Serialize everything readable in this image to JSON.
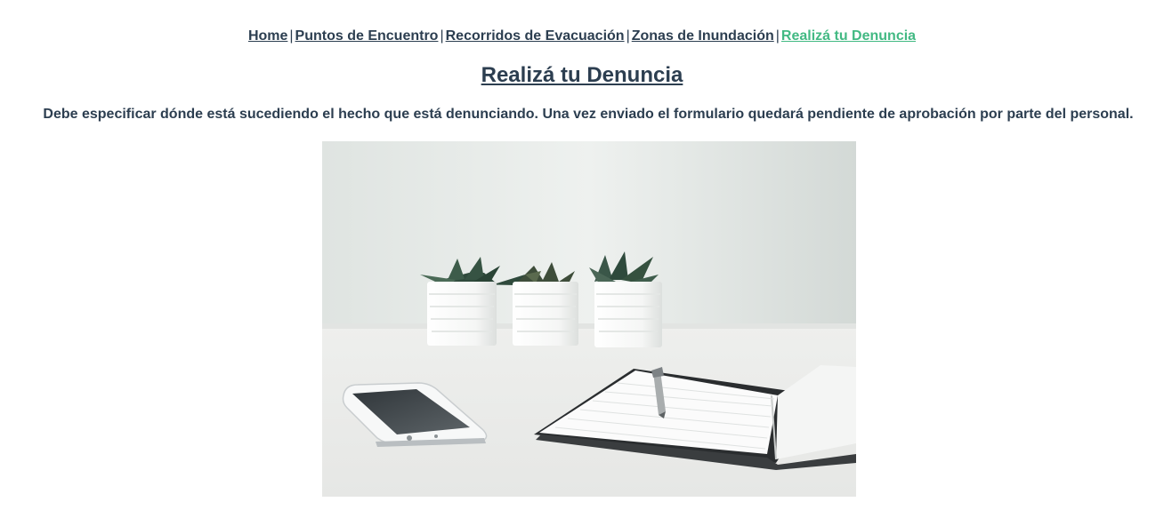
{
  "nav": {
    "items": [
      {
        "label": "Home"
      },
      {
        "label": "Puntos de Encuentro"
      },
      {
        "label": "Recorridos de Evacuación"
      },
      {
        "label": "Zonas de Inundación"
      },
      {
        "label": "Realizá tu Denuncia",
        "active": true
      }
    ],
    "separator": "|"
  },
  "main": {
    "title": "Realizá tu Denuncia",
    "description": "Debe especificar dónde está sucediendo el hecho que está denunciando. Una vez enviado el formulario quedará pendiente de aprobación por parte del personal."
  },
  "colors": {
    "text": "#2c3e50",
    "active_link": "#42b983"
  }
}
